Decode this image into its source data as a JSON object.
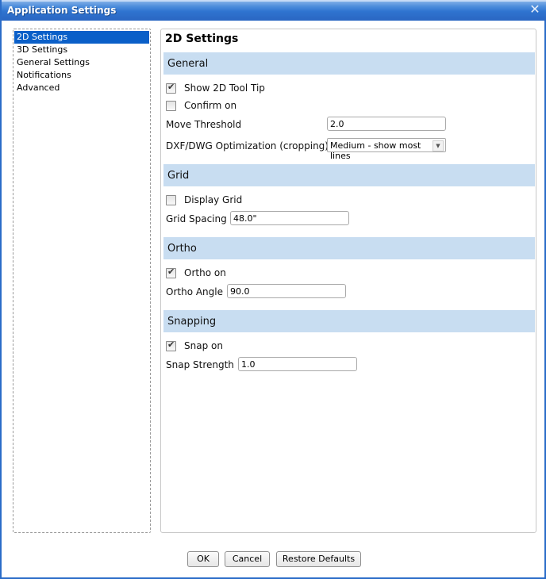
{
  "window": {
    "title": "Application Settings"
  },
  "nav": {
    "items": [
      {
        "label": "2D Settings",
        "selected": true
      },
      {
        "label": "3D Settings",
        "selected": false
      },
      {
        "label": "General Settings",
        "selected": false
      },
      {
        "label": "Notifications",
        "selected": false
      },
      {
        "label": "Advanced",
        "selected": false
      }
    ]
  },
  "content": {
    "title": "2D Settings",
    "general": {
      "header": "General",
      "show_tooltip": {
        "label": "Show 2D Tool Tip",
        "checked": true
      },
      "confirm_on": {
        "label": "Confirm on",
        "checked": false
      },
      "move_threshold": {
        "label": "Move Threshold",
        "value": "2.0"
      },
      "optimization": {
        "label": "DXF/DWG Optimization (cropping)",
        "value": "Medium - show most lines"
      }
    },
    "grid": {
      "header": "Grid",
      "display_grid": {
        "label": "Display Grid",
        "checked": false
      },
      "grid_spacing": {
        "label": "Grid Spacing",
        "value": "48.0\""
      }
    },
    "ortho": {
      "header": "Ortho",
      "ortho_on": {
        "label": "Ortho on",
        "checked": true
      },
      "ortho_angle": {
        "label": "Ortho Angle",
        "value": "90.0"
      }
    },
    "snapping": {
      "header": "Snapping",
      "snap_on": {
        "label": "Snap on",
        "checked": true
      },
      "snap_strength": {
        "label": "Snap Strength",
        "value": "1.0"
      }
    }
  },
  "buttons": {
    "ok": "OK",
    "cancel": "Cancel",
    "restore": "Restore Defaults"
  },
  "icons": {
    "close": "✕",
    "check": "✔",
    "dropdown": "▼"
  }
}
